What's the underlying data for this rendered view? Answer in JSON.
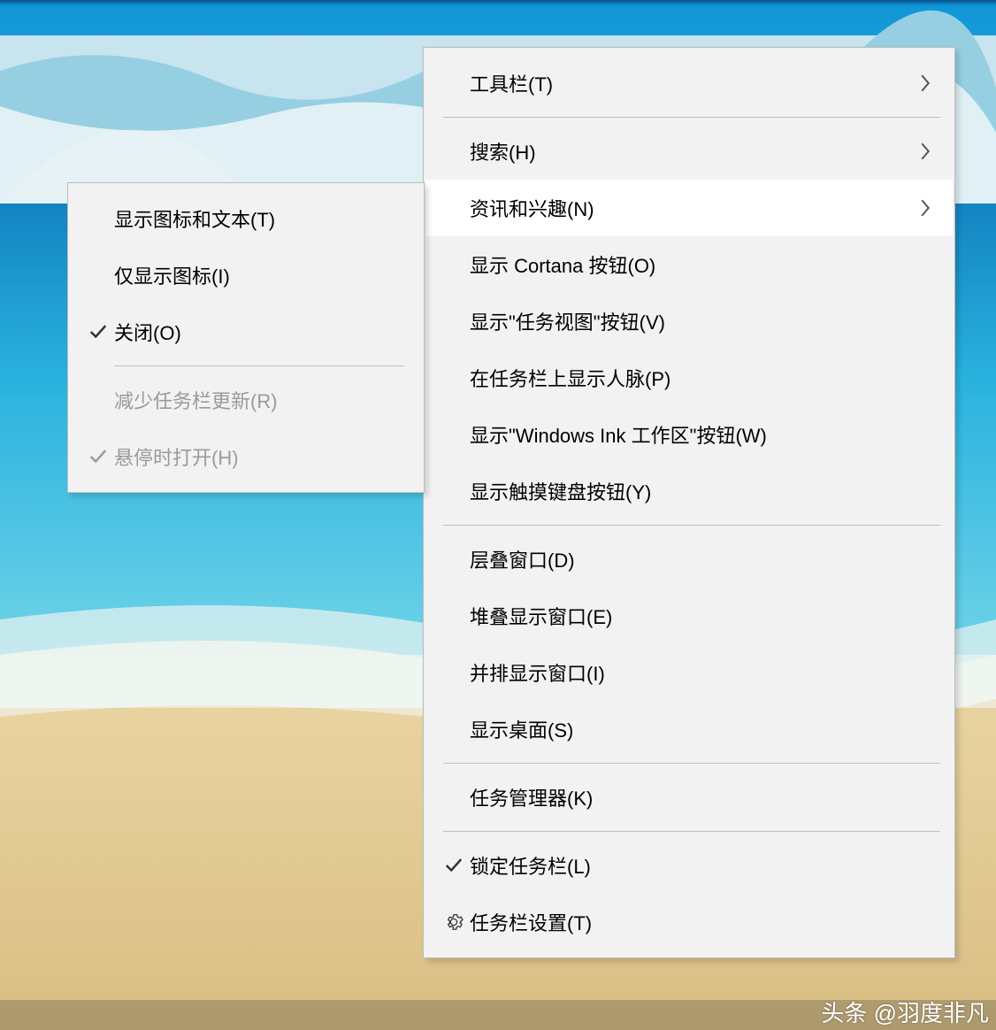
{
  "main_menu": {
    "toolbars": "工具栏(T)",
    "search": "搜索(H)",
    "news_interests": "资讯和兴趣(N)",
    "show_cortana": "显示 Cortana 按钮(O)",
    "show_taskview": "显示\"任务视图\"按钮(V)",
    "show_people": "在任务栏上显示人脉(P)",
    "show_wink": "显示\"Windows Ink 工作区\"按钮(W)",
    "show_touchkb": "显示触摸键盘按钮(Y)",
    "cascade": "层叠窗口(D)",
    "stacked": "堆叠显示窗口(E)",
    "sidebyside": "并排显示窗口(I)",
    "show_desktop": "显示桌面(S)",
    "task_manager": "任务管理器(K)",
    "lock_taskbar": "锁定任务栏(L)",
    "taskbar_settings": "任务栏设置(T)"
  },
  "sub_menu": {
    "icon_text": "显示图标和文本(T)",
    "icon_only": "仅显示图标(I)",
    "off": "关闭(O)",
    "reduce_updates": "减少任务栏更新(R)",
    "open_on_hover": "悬停时打开(H)"
  },
  "watermark": "头条 @羽度非凡"
}
